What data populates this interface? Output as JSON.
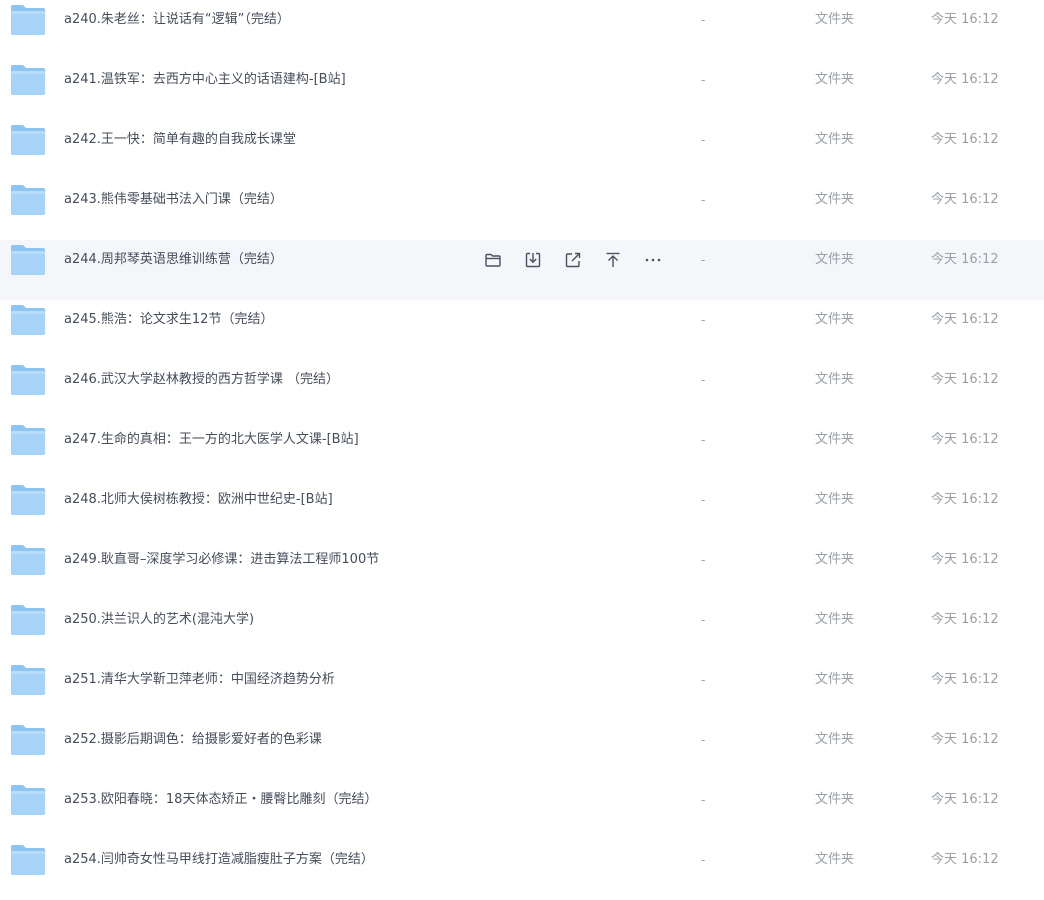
{
  "files": [
    {
      "name": "a240.朱老丝：让说话有“逻辑”（完结）",
      "size": "-",
      "type": "文件夹",
      "time": "今天 16:12"
    },
    {
      "name": "a241.温铁军：去西方中心主义的话语建构-[B站]",
      "size": "-",
      "type": "文件夹",
      "time": "今天 16:12"
    },
    {
      "name": "a242.王一快：简单有趣的自我成长课堂",
      "size": "-",
      "type": "文件夹",
      "time": "今天 16:12"
    },
    {
      "name": "a243.熊伟零基础书法入门课（完结）",
      "size": "-",
      "type": "文件夹",
      "time": "今天 16:12"
    },
    {
      "name": "a244.周邦琴英语思维训练营（完结）",
      "size": "-",
      "type": "文件夹",
      "time": "今天 16:12"
    },
    {
      "name": "a245.熊浩：论文求生12节（完结）",
      "size": "-",
      "type": "文件夹",
      "time": "今天 16:12"
    },
    {
      "name": "a246.武汉大学赵林教授的西方哲学课 （完结）",
      "size": "-",
      "type": "文件夹",
      "time": "今天 16:12"
    },
    {
      "name": "a247.生命的真相：王一方的北大医学人文课-[B站]",
      "size": "-",
      "type": "文件夹",
      "time": "今天 16:12"
    },
    {
      "name": "a248.北师大侯树栋教授：欧洲中世纪史-[B站]",
      "size": "-",
      "type": "文件夹",
      "time": "今天 16:12"
    },
    {
      "name": "a249.耿直哥–深度学习必修课：进击算法工程师100节",
      "size": "-",
      "type": "文件夹",
      "time": "今天 16:12"
    },
    {
      "name": "a250.洪兰识人的艺术(混沌大学)",
      "size": "-",
      "type": "文件夹",
      "time": "今天 16:12"
    },
    {
      "name": "a251.清华大学靳卫萍老师：中国经济趋势分析",
      "size": "-",
      "type": "文件夹",
      "time": "今天 16:12"
    },
    {
      "name": "a252.摄影后期调色：给摄影爱好者的色彩课",
      "size": "-",
      "type": "文件夹",
      "time": "今天 16:12"
    },
    {
      "name": "a253.欧阳春晓：18天体态矫正・腰臀比雕刻（完结）",
      "size": "-",
      "type": "文件夹",
      "time": "今天 16:12"
    },
    {
      "name": "a254.闫帅奇女性马甲线打造减脂瘦肚子方案（完结）",
      "size": "-",
      "type": "文件夹",
      "time": "今天 16:12"
    }
  ],
  "hovered_row": 4,
  "row_actions": [
    {
      "icon": "folder-open-icon",
      "name": "open-folder-button"
    },
    {
      "icon": "download-icon",
      "name": "download-button"
    },
    {
      "icon": "share-icon",
      "name": "share-button"
    },
    {
      "icon": "pin-top-icon",
      "name": "pin-top-button"
    },
    {
      "icon": "more-icon",
      "name": "more-button"
    }
  ],
  "colors": {
    "text": "#454d5a",
    "muted": "#9a9fa8",
    "hover_bg": "#f5f6f9",
    "folder_back": "#8cc4f2",
    "folder_front": "#a7d3f8"
  }
}
